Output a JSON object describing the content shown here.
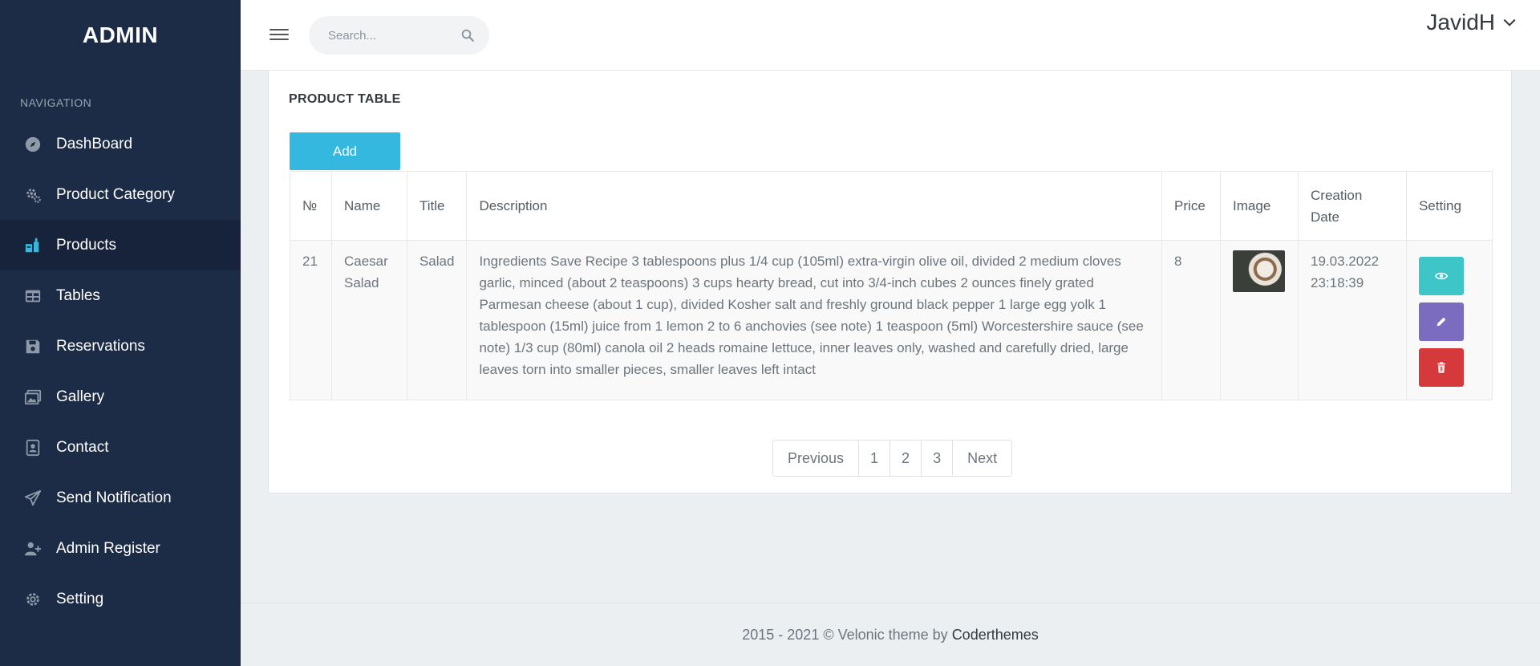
{
  "brand": "ADMIN",
  "nav": {
    "title": "NAVIGATION",
    "items": [
      {
        "label": "DashBoard",
        "icon": "compass-icon"
      },
      {
        "label": "Product Category",
        "icon": "cogs-icon"
      },
      {
        "label": "Products",
        "icon": "products-icon"
      },
      {
        "label": "Tables",
        "icon": "table-icon"
      },
      {
        "label": "Reservations",
        "icon": "floppy-icon"
      },
      {
        "label": "Gallery",
        "icon": "images-icon"
      },
      {
        "label": "Contact",
        "icon": "contact-icon"
      },
      {
        "label": "Send Notification",
        "icon": "paper-plane-icon"
      },
      {
        "label": "Admin Register",
        "icon": "user-plus-icon"
      },
      {
        "label": "Setting",
        "icon": "gear-icon"
      }
    ],
    "active_index": 2
  },
  "topbar": {
    "search_placeholder": "Search...",
    "user_name": "JavidH"
  },
  "card": {
    "title": "PRODUCT TABLE",
    "add_label": "Add"
  },
  "table": {
    "headers": {
      "no": "№",
      "name": "Name",
      "title": "Title",
      "description": "Description",
      "price": "Price",
      "image": "Image",
      "date": "Creation Date",
      "setting": "Setting"
    },
    "rows": [
      {
        "no": "21",
        "name": "Caesar Salad",
        "title": "Salad",
        "description": "Ingredients Save Recipe 3 tablespoons plus 1/4 cup (105ml) extra-virgin olive oil, divided 2 medium cloves garlic, minced (about 2 teaspoons) 3 cups hearty bread, cut into 3/4-inch cubes 2 ounces finely grated Parmesan cheese (about 1 cup), divided Kosher salt and freshly ground black pepper 1 large egg yolk 1 tablespoon (15ml) juice from 1 lemon 2 to 6 anchovies (see note) 1 teaspoon (5ml) Worcestershire sauce (see note) 1/3 cup (80ml) canola oil 2 heads romaine lettuce, inner leaves only, washed and carefully dried, large leaves torn into smaller pieces, smaller leaves left intact",
        "price": "8",
        "date": "19.03.2022 23:18:39"
      }
    ]
  },
  "pagination": {
    "previous": "Previous",
    "pages": [
      "1",
      "2",
      "3"
    ],
    "next": "Next"
  },
  "footer": {
    "text": "2015 - 2021 © Velonic theme by",
    "link": "Coderthemes"
  },
  "colors": {
    "sidebar": "#1c2b46",
    "add_button": "#35b8e0",
    "view_button": "#3ec5c7",
    "edit_button": "#7b6cc0",
    "delete_button": "#d6393c"
  }
}
